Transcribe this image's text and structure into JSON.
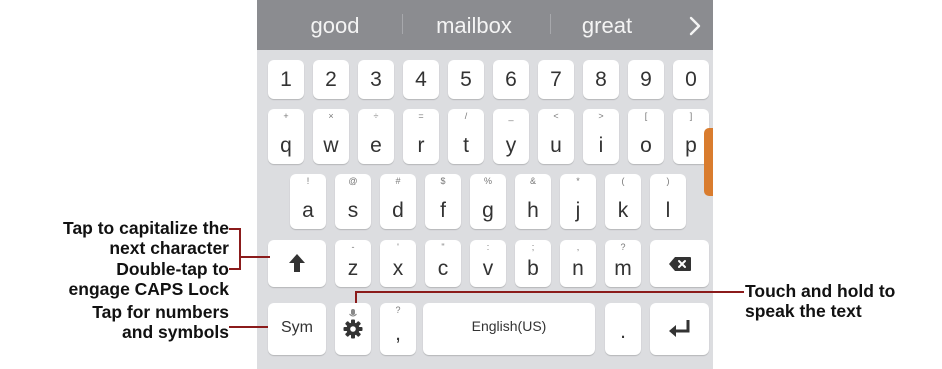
{
  "suggestions": [
    "good",
    "mailbox",
    "great"
  ],
  "suggest_more_icon": "chevron-right-icon",
  "rows": {
    "numbers": [
      "1",
      "2",
      "3",
      "4",
      "5",
      "6",
      "7",
      "8",
      "9",
      "0"
    ],
    "row1": [
      {
        "key": "q",
        "hint": "+"
      },
      {
        "key": "w",
        "hint": "×"
      },
      {
        "key": "e",
        "hint": "÷"
      },
      {
        "key": "r",
        "hint": "="
      },
      {
        "key": "t",
        "hint": "/"
      },
      {
        "key": "y",
        "hint": "_"
      },
      {
        "key": "u",
        "hint": "<"
      },
      {
        "key": "i",
        "hint": ">"
      },
      {
        "key": "o",
        "hint": "["
      },
      {
        "key": "p",
        "hint": "]"
      }
    ],
    "row2": [
      {
        "key": "a",
        "hint": "!"
      },
      {
        "key": "s",
        "hint": "@"
      },
      {
        "key": "d",
        "hint": "#"
      },
      {
        "key": "f",
        "hint": "$"
      },
      {
        "key": "g",
        "hint": "%"
      },
      {
        "key": "h",
        "hint": "&"
      },
      {
        "key": "j",
        "hint": "*"
      },
      {
        "key": "k",
        "hint": "("
      },
      {
        "key": "l",
        "hint": ")"
      }
    ],
    "row3": [
      {
        "key": "z",
        "hint": "-"
      },
      {
        "key": "x",
        "hint": "'"
      },
      {
        "key": "c",
        "hint": "\""
      },
      {
        "key": "v",
        "hint": ":"
      },
      {
        "key": "b",
        "hint": ";"
      },
      {
        "key": "n",
        "hint": ","
      },
      {
        "key": "m",
        "hint": "?"
      }
    ]
  },
  "bottom_row": {
    "sym_label": "Sym",
    "comma_key": ",",
    "comma_hint": "?",
    "space_label": "English(US)",
    "period_key": "."
  },
  "annotations": {
    "shift_tap": [
      "Tap to capitalize the",
      "next character"
    ],
    "shift_double": [
      "Double-tap to",
      "engage CAPS Lock"
    ],
    "sym": [
      "Tap for numbers",
      "and symbols"
    ],
    "mic": [
      "Touch and hold to",
      "speak the text"
    ]
  },
  "colors": {
    "keyboard_bg": "#dcdde0",
    "suggest_bar": "#8b8c90",
    "callout_line": "#8b1b1b",
    "side_tab": "#d97c2e"
  }
}
